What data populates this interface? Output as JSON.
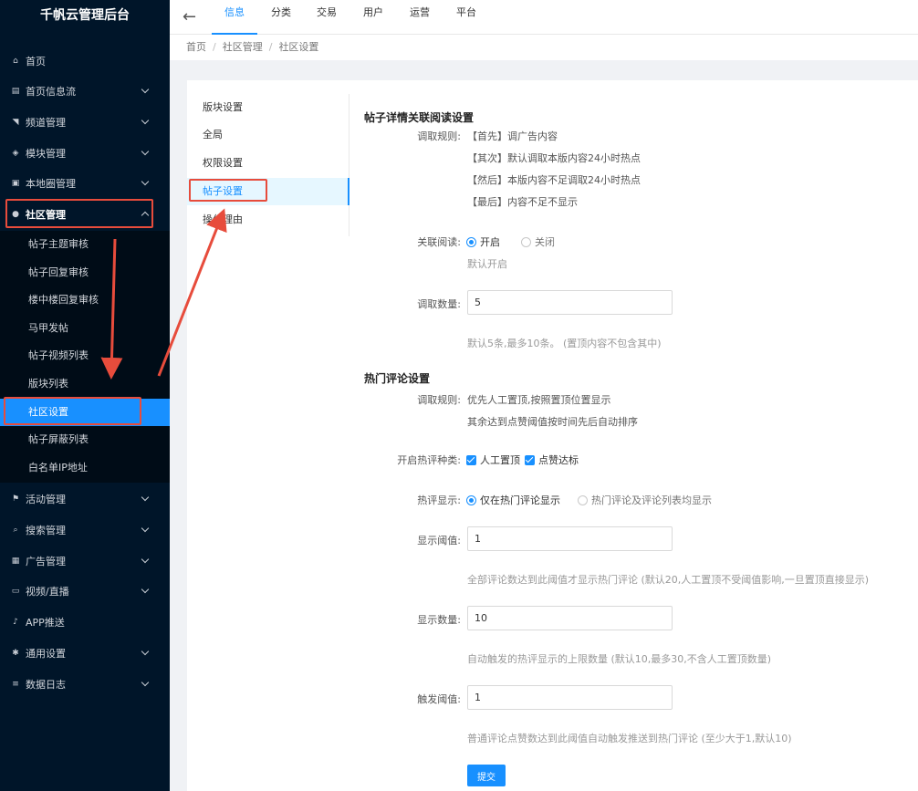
{
  "sidebar": {
    "title": "千帆云管理后台",
    "items": [
      {
        "label": "首页",
        "icon": "home-icon",
        "glyph": "⌂",
        "has_children": false
      },
      {
        "label": "首页信息流",
        "icon": "document-icon",
        "glyph": "▤",
        "has_children": true
      },
      {
        "label": "频道管理",
        "icon": "rss-icon",
        "glyph": "◥",
        "has_children": true
      },
      {
        "label": "模块管理",
        "icon": "cube-icon",
        "glyph": "◈",
        "has_children": true
      },
      {
        "label": "本地圈管理",
        "icon": "map-icon",
        "glyph": "▣",
        "has_children": true
      },
      {
        "label": "社区管理",
        "icon": "user-circle-icon",
        "glyph": "●",
        "has_children": true,
        "open": true
      }
    ],
    "submenu": [
      "帖子主题审核",
      "帖子回复审核",
      "楼中楼回复审核",
      "马甲发帖",
      "帖子视频列表",
      "版块列表",
      "社区设置",
      "帖子屏蔽列表",
      "白名单IP地址"
    ],
    "active_submenu": "社区设置",
    "bottom_items": [
      {
        "label": "活动管理",
        "icon": "flag-icon",
        "glyph": "⚑",
        "has_children": true
      },
      {
        "label": "搜索管理",
        "icon": "search-icon",
        "glyph": "⌕",
        "has_children": true
      },
      {
        "label": "广告管理",
        "icon": "image-icon",
        "glyph": "▦",
        "has_children": true
      },
      {
        "label": "视频/直播",
        "icon": "video-icon",
        "glyph": "▭",
        "has_children": true
      },
      {
        "label": "APP推送",
        "icon": "bell-icon",
        "glyph": "♪",
        "has_children": false
      },
      {
        "label": "通用设置",
        "icon": "gear-icon",
        "glyph": "✱",
        "has_children": true
      },
      {
        "label": "数据日志",
        "icon": "list-icon",
        "glyph": "≡",
        "has_children": true
      }
    ]
  },
  "topbar": {
    "tabs": [
      "信息",
      "分类",
      "交易",
      "用户",
      "运营",
      "平台"
    ],
    "active_tab": "信息"
  },
  "breadcrumb": [
    "首页",
    "社区管理",
    "社区设置"
  ],
  "inner_nav": {
    "items": [
      "版块设置",
      "全局",
      "权限设置",
      "帖子设置",
      "操作理由"
    ],
    "active": "帖子设置"
  },
  "related_reading": {
    "title": "帖子详情关联阅读设置",
    "rule_label": "调取规则:",
    "rules": [
      "【首先】调广告内容",
      "【其次】默认调取本版内容24小时热点",
      "【然后】本版内容不足调取24小时热点",
      "【最后】内容不足不显示"
    ],
    "toggle_label": "关联阅读:",
    "toggle_on": "开启",
    "toggle_off": "关闭",
    "toggle_value": "开启",
    "toggle_hint": "默认开启",
    "count_label": "调取数量:",
    "count_value": "5",
    "count_hint": "默认5条,最多10条。 (置顶内容不包含其中)"
  },
  "hot_comments": {
    "title": "热门评论设置",
    "rule_label": "调取规则:",
    "rules": [
      "优先人工置顶,按照置顶位置显示",
      "其余达到点赞阈值按时间先后自动排序"
    ],
    "types_label": "开启热评种类:",
    "types": [
      "人工置顶",
      "点赞达标"
    ],
    "display_label": "热评显示:",
    "display_options": [
      "仅在热门评论显示",
      "热门评论及评论列表均显示"
    ],
    "display_value": "仅在热门评论显示",
    "threshold_label": "显示阈值:",
    "threshold_value": "1",
    "threshold_hint": "全部评论数达到此阈值才显示热门评论 (默认20,人工置顶不受阈值影响,一旦置顶直接显示)",
    "count_label": "显示数量:",
    "count_value": "10",
    "count_hint": "自动触发的热评显示的上限数量 (默认10,最多30,不含人工置顶数量)",
    "trigger_label": "触发阈值:",
    "trigger_value": "1",
    "trigger_hint": "普通评论点赞数达到此阈值自动触发推送到热门评论 (至少大于1,默认10)",
    "submit_label": "提交"
  },
  "colors": {
    "sidebar_bg": "#001529",
    "accent": "#1890ff",
    "annotation_red": "#e74c3c"
  }
}
